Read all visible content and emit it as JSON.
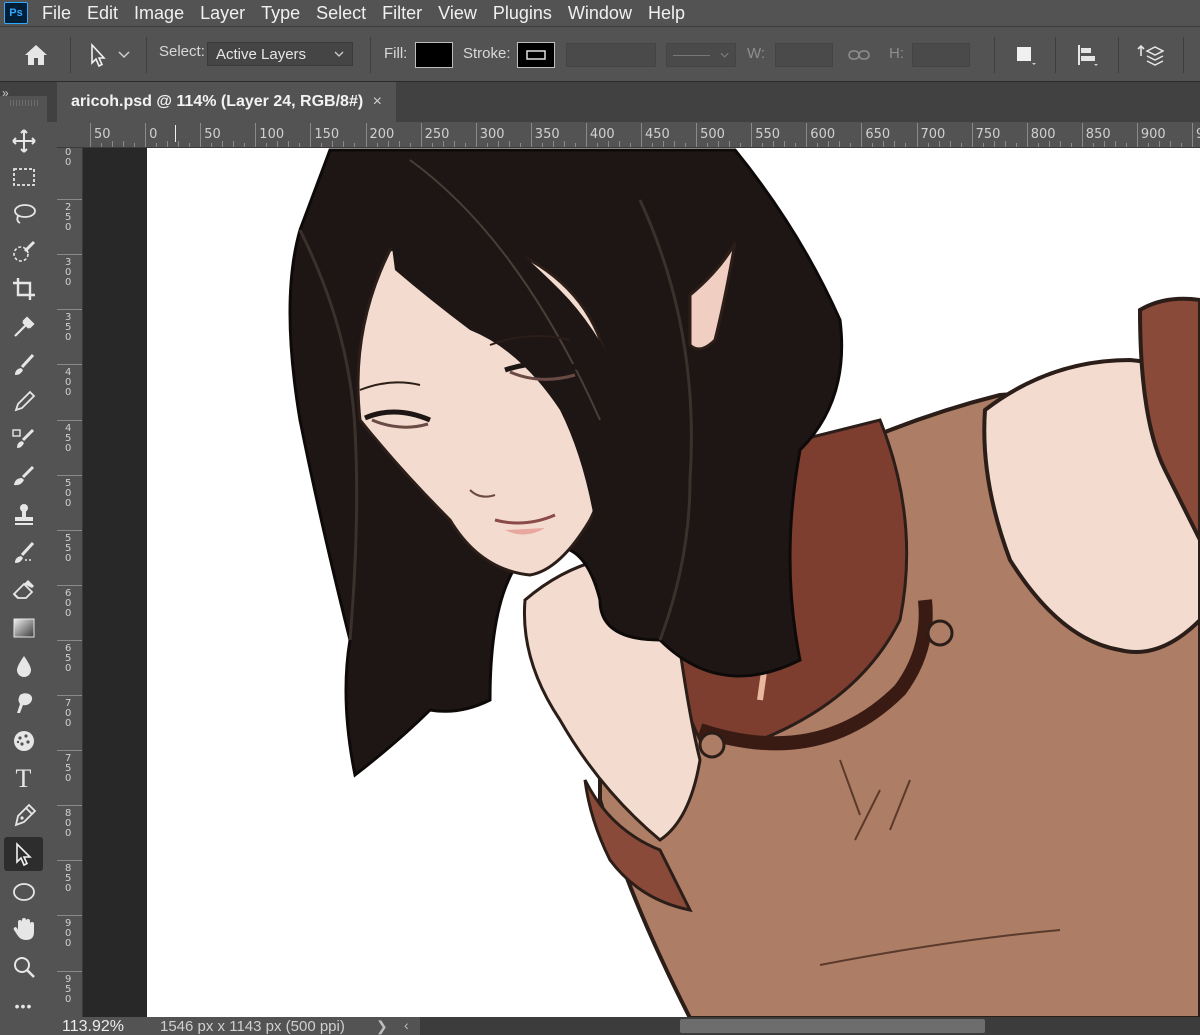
{
  "app": {
    "logo_text": "Ps"
  },
  "menu": [
    "File",
    "Edit",
    "Image",
    "Layer",
    "Type",
    "Select",
    "Filter",
    "View",
    "Plugins",
    "Window",
    "Help"
  ],
  "options": {
    "select_label": "Select:",
    "select_value": "Active Layers",
    "fill_label": "Fill:",
    "fill_color": "#000000",
    "stroke_label": "Stroke:",
    "w_label": "W:",
    "h_label": "H:"
  },
  "document": {
    "tab_title": "aricoh.psd @ 114% (Layer 24, RGB/8#)",
    "close_glyph": "×",
    "panel_collapse_glyph": "»"
  },
  "ruler": {
    "top_labels": [
      "50",
      "0",
      "50",
      "100",
      "150",
      "200",
      "250",
      "300",
      "350",
      "400",
      "450",
      "500",
      "550",
      "600",
      "650",
      "700",
      "750",
      "800",
      "850",
      "900",
      "9"
    ],
    "left_labels": [
      "00",
      "250",
      "300",
      "350",
      "400",
      "450",
      "500",
      "550",
      "600",
      "650",
      "700",
      "750",
      "800",
      "850",
      "900",
      "950"
    ]
  },
  "tools": [
    {
      "name": "move-tool",
      "icon": "move-icon"
    },
    {
      "name": "marquee-tool",
      "icon": "rect-marquee-icon"
    },
    {
      "name": "lasso-tool",
      "icon": "lasso-icon"
    },
    {
      "name": "quick-select-tool",
      "icon": "quick-select-icon"
    },
    {
      "name": "crop-tool",
      "icon": "crop-icon"
    },
    {
      "name": "eyedropper-tool",
      "icon": "eyedropper-icon"
    },
    {
      "name": "brush-tool",
      "icon": "brush-icon"
    },
    {
      "name": "pencil-tool",
      "icon": "pencil-icon"
    },
    {
      "name": "clone-tool",
      "icon": "clone-stamp-icon"
    },
    {
      "name": "history-brush-tool",
      "icon": "history-brush-icon"
    },
    {
      "name": "stamp-tool",
      "icon": "stamp-icon"
    },
    {
      "name": "mixer-brush-tool",
      "icon": "mixer-brush-icon"
    },
    {
      "name": "eraser-tool",
      "icon": "eraser-icon"
    },
    {
      "name": "gradient-tool",
      "icon": "gradient-icon"
    },
    {
      "name": "blur-tool",
      "icon": "blur-icon"
    },
    {
      "name": "smudge-tool",
      "icon": "smudge-icon"
    },
    {
      "name": "sponge-tool",
      "icon": "sponge-icon"
    },
    {
      "name": "type-tool",
      "icon": "type-icon"
    },
    {
      "name": "pen-tool",
      "icon": "pen-icon"
    },
    {
      "name": "path-select-tool",
      "icon": "direct-select-icon",
      "active": true
    },
    {
      "name": "ellipse-tool",
      "icon": "ellipse-icon"
    },
    {
      "name": "hand-tool",
      "icon": "hand-icon"
    },
    {
      "name": "zoom-tool",
      "icon": "zoom-icon"
    },
    {
      "name": "more-tools",
      "icon": "more-icon"
    }
  ],
  "tool_glyphs": {
    "type": "T",
    "more": "•••"
  },
  "status": {
    "zoom": "113.92%",
    "doc_size": "1546 px x 1143 px (500 ppi)",
    "next_glyph": "❯",
    "prev_glyph": "‹"
  },
  "colors": {
    "ui_bg": "#535353",
    "canvas_white": "#ffffff",
    "hair": "#1e1614",
    "skin": "#f2d8cc",
    "tunic": "#ae7d65",
    "trim": "#7d3e30",
    "trim_dark": "#3a1b14"
  }
}
